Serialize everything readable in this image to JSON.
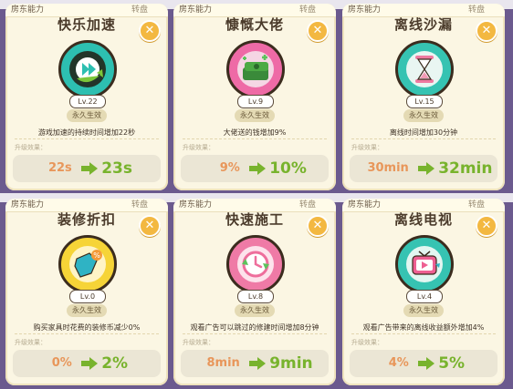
{
  "header_label": "房东能力",
  "card_decor": "转盘",
  "perm_label": "永久生效",
  "upgrade_label": "升级效果：",
  "close_glyph": "✕",
  "colors": {
    "from": "#e8965a",
    "to": "#78b32d",
    "close": "#f3b841",
    "arrow": "#78b32d"
  },
  "cards": [
    {
      "title": "快乐加速",
      "level": "Lv.22",
      "desc": "游戏加速的持续时间增加22秒",
      "from": "22s",
      "to": "23s",
      "icon": "fast-forward-icon"
    },
    {
      "title": "慷慨大佬",
      "level": "Lv.9",
      "desc": "大佬送的钱增加9%",
      "from": "9%",
      "to": "10%",
      "icon": "money-stack-icon"
    },
    {
      "title": "离线沙漏",
      "level": "Lv.15",
      "desc": "离线时间增加30分钟",
      "from": "30min",
      "to": "32min",
      "icon": "hourglass-icon"
    },
    {
      "title": "装修折扣",
      "level": "Lv.0",
      "desc": "购买家具时花费的装修币减少0%",
      "from": "0%",
      "to": "2%",
      "icon": "discount-tag-icon"
    },
    {
      "title": "快速施工",
      "level": "Lv.8",
      "desc": "观看广告可以跳过的修建时间增加8分钟",
      "from": "8min",
      "to": "9min",
      "icon": "clock-refresh-icon"
    },
    {
      "title": "离线电视",
      "level": "Lv.4",
      "desc": "观看广告带来的离线收益额外增加4%",
      "from": "4%",
      "to": "5%",
      "icon": "tv-icon"
    }
  ]
}
